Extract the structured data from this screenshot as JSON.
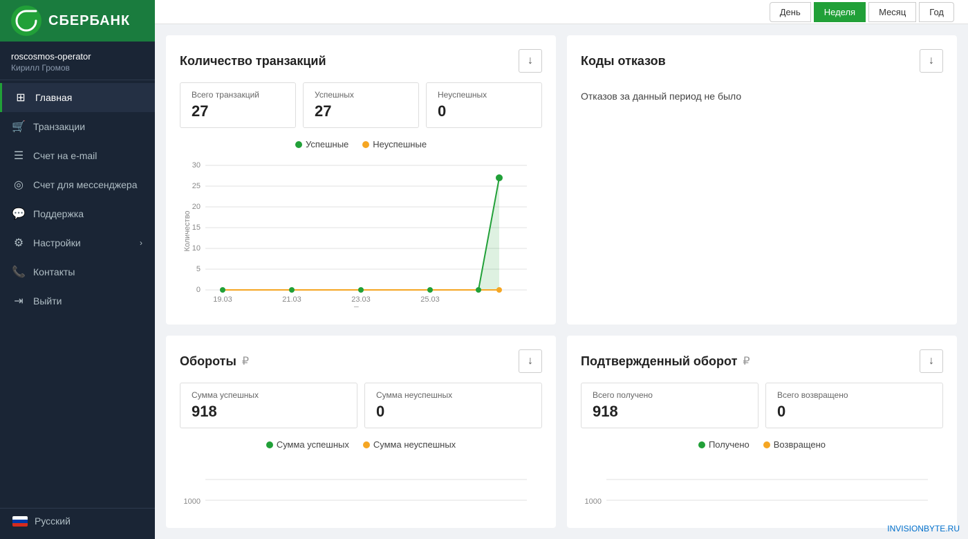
{
  "sidebar": {
    "logo_text": "СБЕРБАНК",
    "user": {
      "username": "roscosmos-operator",
      "fullname": "Кирилл Громов"
    },
    "nav_items": [
      {
        "id": "home",
        "label": "Главная",
        "icon": "⊞",
        "active": true
      },
      {
        "id": "transactions",
        "label": "Транзакции",
        "icon": "🛒"
      },
      {
        "id": "email-account",
        "label": "Счет на e-mail",
        "icon": "≡"
      },
      {
        "id": "messenger-account",
        "label": "Счет для мессенджера",
        "icon": "◎"
      },
      {
        "id": "support",
        "label": "Поддержка",
        "icon": "💬"
      },
      {
        "id": "settings",
        "label": "Настройки",
        "icon": "⚙",
        "has_chevron": true
      },
      {
        "id": "contacts",
        "label": "Контакты",
        "icon": "📞"
      },
      {
        "id": "logout",
        "label": "Выйти",
        "icon": "⇥"
      }
    ],
    "language": "Русский"
  },
  "topbar": {
    "period_buttons": [
      {
        "id": "day",
        "label": "День"
      },
      {
        "id": "week",
        "label": "Неделя",
        "active": true
      },
      {
        "id": "month",
        "label": "Месяц"
      },
      {
        "id": "year",
        "label": "Год"
      }
    ]
  },
  "transactions_card": {
    "title": "Количество транзакций",
    "stats": [
      {
        "id": "total",
        "label": "Всего транзакций",
        "value": "27"
      },
      {
        "id": "success",
        "label": "Успешных",
        "value": "27"
      },
      {
        "id": "fail",
        "label": "Неуспешных",
        "value": "0"
      }
    ],
    "legend": [
      {
        "id": "success",
        "label": "Успешные",
        "color": "#21a038"
      },
      {
        "id": "fail",
        "label": "Неуспешные",
        "color": "#f5a623"
      }
    ],
    "chart": {
      "y_title": "Количество",
      "x_title": "Период",
      "x_labels": [
        "19.03",
        "21.03",
        "23.03",
        "25.03",
        ""
      ],
      "y_labels": [
        "0",
        "5",
        "10",
        "15",
        "20",
        "25",
        "30"
      ],
      "download_label": "↓"
    }
  },
  "refusals_card": {
    "title": "Коды отказов",
    "empty_text": "Отказов за данный период не было",
    "download_label": "↓"
  },
  "turnover_card": {
    "title": "Обороты",
    "currency": "₽",
    "stats": [
      {
        "id": "success_sum",
        "label": "Сумма успешных",
        "value": "918"
      },
      {
        "id": "fail_sum",
        "label": "Сумма неуспешных",
        "value": "0"
      }
    ],
    "legend": [
      {
        "id": "success",
        "label": "Сумма успешных",
        "color": "#21a038"
      },
      {
        "id": "fail",
        "label": "Сумма неуспешных",
        "color": "#f5a623"
      }
    ],
    "chart_y_label": "1000",
    "download_label": "↓"
  },
  "confirmed_turnover_card": {
    "title": "Подтвержденный оборот",
    "currency": "₽",
    "stats": [
      {
        "id": "received",
        "label": "Всего получено",
        "value": "918"
      },
      {
        "id": "returned",
        "label": "Всего возвращено",
        "value": "0"
      }
    ],
    "legend": [
      {
        "id": "received",
        "label": "Получено",
        "color": "#21a038"
      },
      {
        "id": "returned",
        "label": "Возвращено",
        "color": "#f5a623"
      }
    ],
    "chart_y_label": "1000",
    "download_label": "↓"
  },
  "watermark": {
    "text": "INVISIONBYTE",
    "suffix": ".RU"
  }
}
